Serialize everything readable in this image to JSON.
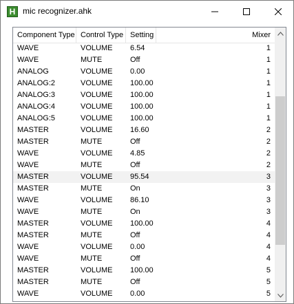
{
  "window": {
    "title": "mic recognizer.ahk",
    "app_icon_letter": "H"
  },
  "columns": [
    "Component Type",
    "Control Type",
    "Setting",
    "Mixer"
  ],
  "rows": [
    [
      "WAVE",
      "VOLUME",
      "6.54",
      "1"
    ],
    [
      "WAVE",
      "MUTE",
      "Off",
      "1"
    ],
    [
      "ANALOG",
      "VOLUME",
      "0.00",
      "1"
    ],
    [
      "ANALOG:2",
      "VOLUME",
      "100.00",
      "1"
    ],
    [
      "ANALOG:3",
      "VOLUME",
      "100.00",
      "1"
    ],
    [
      "ANALOG:4",
      "VOLUME",
      "100.00",
      "1"
    ],
    [
      "ANALOG:5",
      "VOLUME",
      "100.00",
      "1"
    ],
    [
      "MASTER",
      "VOLUME",
      "16.60",
      "2"
    ],
    [
      "MASTER",
      "MUTE",
      "Off",
      "2"
    ],
    [
      "WAVE",
      "VOLUME",
      "4.85",
      "2"
    ],
    [
      "WAVE",
      "MUTE",
      "Off",
      "2"
    ],
    [
      "MASTER",
      "VOLUME",
      "95.54",
      "3"
    ],
    [
      "MASTER",
      "MUTE",
      "On",
      "3"
    ],
    [
      "WAVE",
      "VOLUME",
      "86.10",
      "3"
    ],
    [
      "WAVE",
      "MUTE",
      "On",
      "3"
    ],
    [
      "MASTER",
      "VOLUME",
      "100.00",
      "4"
    ],
    [
      "MASTER",
      "MUTE",
      "Off",
      "4"
    ],
    [
      "WAVE",
      "VOLUME",
      "0.00",
      "4"
    ],
    [
      "WAVE",
      "MUTE",
      "Off",
      "4"
    ],
    [
      "MASTER",
      "VOLUME",
      "100.00",
      "5"
    ],
    [
      "MASTER",
      "MUTE",
      "Off",
      "5"
    ],
    [
      "WAVE",
      "VOLUME",
      "0.00",
      "5"
    ]
  ],
  "selected_row_index": 11,
  "colors": {
    "selected_row_bg": "#f2f2f2",
    "app_icon_green": "#3c8d2f",
    "scroll_thumb": "#cdcdcd"
  },
  "icons": {
    "minimize": "minimize-icon",
    "maximize": "maximize-icon",
    "close": "close-icon",
    "scroll_up": "chevron-up-icon",
    "scroll_down": "chevron-down-icon"
  }
}
